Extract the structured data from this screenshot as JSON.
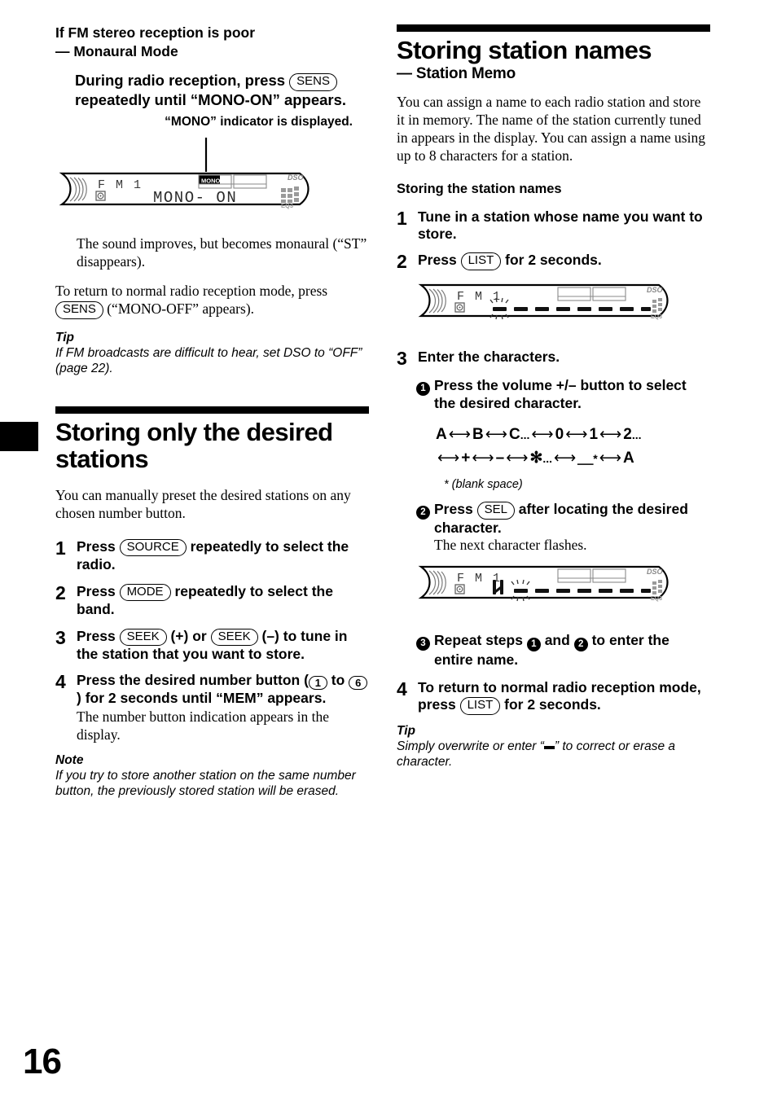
{
  "page": {
    "number": "16"
  },
  "left_column": {
    "heading": "If FM stereo reception is poor",
    "subheading": "— Monaural Mode",
    "instruction": {
      "part1": "During radio reception, press",
      "button": "SENS",
      "part2": "repeatedly until “MONO-ON” appears."
    },
    "callout": "“MONO” indicator is displayed.",
    "display1": {
      "band": "FM 1",
      "main_text": "MONO- ON",
      "indicator": "MONO",
      "brand": "DSO",
      "eq_label": "EQ3"
    },
    "after_display": "The sound improves, but becomes monaural (“ST” disappears).",
    "return_text_1": "To return to normal radio reception mode, press",
    "return_button": "SENS",
    "return_text_2": "(“MONO-OFF” appears).",
    "tip_label": "Tip",
    "tip_text": "If FM broadcasts are difficult to hear, set DSO to “OFF” (page 22).",
    "section2": {
      "title": "Storing only the desired stations",
      "intro": "You can manually preset the desired stations on any chosen number button.",
      "steps": [
        {
          "num": "1",
          "pre": "Press",
          "button": "SOURCE",
          "post": "repeatedly to select the radio.",
          "detail": ""
        },
        {
          "num": "2",
          "pre": "Press",
          "button": "MODE",
          "post": "repeatedly to select the band.",
          "detail": ""
        },
        {
          "num": "3",
          "pre": "Press",
          "button": "SEEK",
          "mid": "(+) or",
          "button2": "SEEK",
          "post": "(–) to tune in the station that you want to store.",
          "detail": ""
        },
        {
          "num": "4",
          "pre": "Press the desired number button (",
          "button": "1",
          "mid": "to",
          "button2": "6",
          "post": ") for 2 seconds until “MEM” appears.",
          "detail": "The number button indication appears in the display."
        }
      ],
      "note_label": "Note",
      "note_text": "If you try to store another station on the same number button, the previously stored station will be erased."
    }
  },
  "right_column": {
    "title": "Storing station names",
    "subtitle": "— Station Memo",
    "intro": "You can assign a name to each radio station and store it in memory. The name of the station currently tuned in appears in the display. You can assign a name using up to 8 characters for a station.",
    "section_head": "Storing the station names",
    "step1": {
      "num": "1",
      "text": "Tune in a station whose name you want to store."
    },
    "step2": {
      "num": "2",
      "pre": "Press",
      "button": "LIST",
      "post": "for 2 seconds."
    },
    "display2": {
      "band": "FM 1",
      "brand": "DSO",
      "eq_label": "EQ3",
      "dash_count": 8,
      "flashing_index": 0,
      "entered_chars": ""
    },
    "step3": {
      "num": "3",
      "text": "Enter the characters.",
      "sub1": {
        "marker": "1",
        "text": "Press the volume +/– button to select the desired character."
      },
      "char_sequence_line1": [
        "A",
        "B",
        "C",
        "...",
        "0",
        "1",
        "2",
        "..."
      ],
      "char_sequence_line2": [
        "+",
        "–",
        "✻",
        "...",
        "＿",
        "*",
        "A"
      ],
      "footnote": "*  (blank space)",
      "sub2": {
        "marker": "2",
        "pre": "Press",
        "button": "SEL",
        "post": "after locating the desired character.",
        "detail": "The next character flashes."
      },
      "sub3": {
        "marker": "3",
        "pre": "Repeat steps",
        "m1": "1",
        "mid": "and",
        "m2": "2",
        "post": "to enter the entire name."
      }
    },
    "display3": {
      "band": "FM 1",
      "brand": "DSO",
      "eq_label": "EQ3",
      "dash_count": 8,
      "entered_chars": "H",
      "flashing_index": 1
    },
    "step4": {
      "num": "4",
      "pre": "To return to normal radio reception mode, press",
      "button": "LIST",
      "post": "for 2 seconds."
    },
    "tip_label": "Tip",
    "tip_text_1": "Simply overwrite or enter “",
    "tip_text_2": "” to correct or erase a character."
  }
}
